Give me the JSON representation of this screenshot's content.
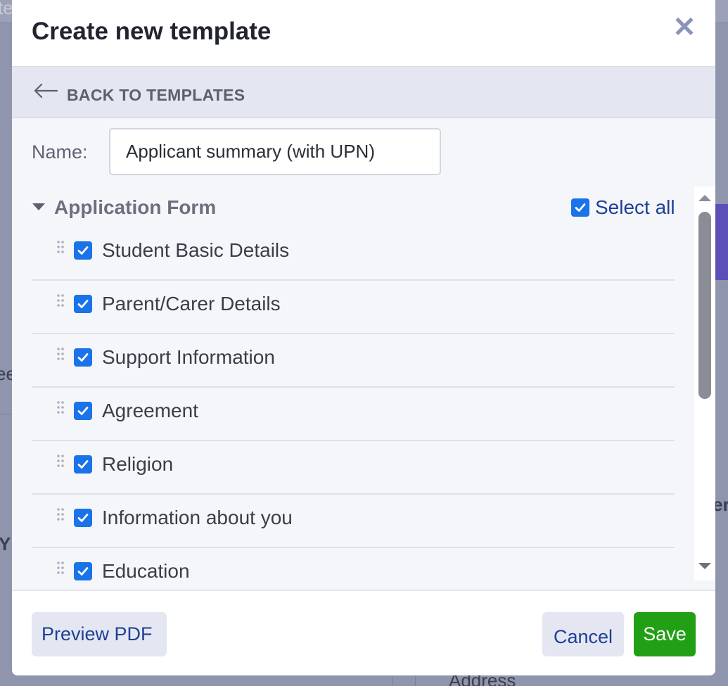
{
  "background": {
    "fragments": [
      "te",
      "ee",
      "Y",
      "er",
      "Address"
    ]
  },
  "modal": {
    "title": "Create new template",
    "close_icon": "close-icon",
    "back_label": "BACK TO TEMPLATES",
    "name_label": "Name:",
    "name_value": "Applicant summary (with UPN)",
    "section": {
      "title": "Application Form",
      "expanded": true,
      "select_all_label": "Select all",
      "select_all_checked": true,
      "items": [
        {
          "label": "Student Basic Details",
          "checked": true
        },
        {
          "label": "Parent/Carer Details",
          "checked": true
        },
        {
          "label": "Support Information",
          "checked": true
        },
        {
          "label": "Agreement",
          "checked": true
        },
        {
          "label": "Religion",
          "checked": true
        },
        {
          "label": "Information about you",
          "checked": true
        },
        {
          "label": "Education",
          "checked": true
        }
      ]
    },
    "footer": {
      "preview_label": "Preview PDF",
      "cancel_label": "Cancel",
      "save_label": "Save"
    }
  },
  "colors": {
    "checkbox": "#1a73e8",
    "link": "#1e3f96",
    "save": "#22a015",
    "overlay": "#8f95ad"
  }
}
